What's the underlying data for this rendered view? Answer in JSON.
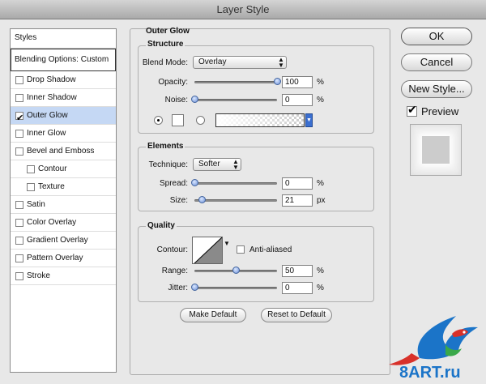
{
  "window": {
    "title": "Layer Style"
  },
  "styles_list": {
    "header": "Styles",
    "blending_options": "Blending Options: Custom",
    "items": [
      {
        "label": "Drop Shadow",
        "checked": false,
        "indent": false,
        "selected": false
      },
      {
        "label": "Inner Shadow",
        "checked": false,
        "indent": false,
        "selected": false
      },
      {
        "label": "Outer Glow",
        "checked": true,
        "indent": false,
        "selected": true
      },
      {
        "label": "Inner Glow",
        "checked": false,
        "indent": false,
        "selected": false
      },
      {
        "label": "Bevel and Emboss",
        "checked": false,
        "indent": false,
        "selected": false
      },
      {
        "label": "Contour",
        "checked": false,
        "indent": true,
        "selected": false
      },
      {
        "label": "Texture",
        "checked": false,
        "indent": true,
        "selected": false
      },
      {
        "label": "Satin",
        "checked": false,
        "indent": false,
        "selected": false
      },
      {
        "label": "Color Overlay",
        "checked": false,
        "indent": false,
        "selected": false
      },
      {
        "label": "Gradient Overlay",
        "checked": false,
        "indent": false,
        "selected": false
      },
      {
        "label": "Pattern Overlay",
        "checked": false,
        "indent": false,
        "selected": false
      },
      {
        "label": "Stroke",
        "checked": false,
        "indent": false,
        "selected": false
      }
    ]
  },
  "outer_glow": {
    "title": "Outer Glow",
    "structure": {
      "title": "Structure",
      "blend_mode_label": "Blend Mode:",
      "blend_mode_value": "Overlay",
      "opacity_label": "Opacity:",
      "opacity_value": "100",
      "opacity_unit": "%",
      "opacity_level": 1.0,
      "noise_label": "Noise:",
      "noise_value": "0",
      "noise_unit": "%",
      "noise_level": 0.0,
      "color_mode": "color"
    },
    "elements": {
      "title": "Elements",
      "technique_label": "Technique:",
      "technique_value": "Softer",
      "spread_label": "Spread:",
      "spread_value": "0",
      "spread_unit": "%",
      "spread_level": 0.0,
      "size_label": "Size:",
      "size_value": "21",
      "size_unit": "px",
      "size_level": 0.084
    },
    "quality": {
      "title": "Quality",
      "contour_label": "Contour:",
      "anti_aliased_label": "Anti-aliased",
      "anti_aliased_checked": false,
      "range_label": "Range:",
      "range_value": "50",
      "range_unit": "%",
      "range_level": 0.5,
      "jitter_label": "Jitter:",
      "jitter_value": "0",
      "jitter_unit": "%",
      "jitter_level": 0.0
    },
    "make_default": "Make Default",
    "reset_default": "Reset to Default"
  },
  "actions": {
    "ok": "OK",
    "cancel": "Cancel",
    "new_style": "New Style...",
    "preview_label": "Preview",
    "preview_checked": true
  },
  "watermark": {
    "text": "8ART.ru"
  },
  "colors": {
    "selection": "#c5d8f4",
    "thumb": "#6c90d8",
    "watermark_blue": "#1b74c8",
    "watermark_red": "#d8312a"
  }
}
